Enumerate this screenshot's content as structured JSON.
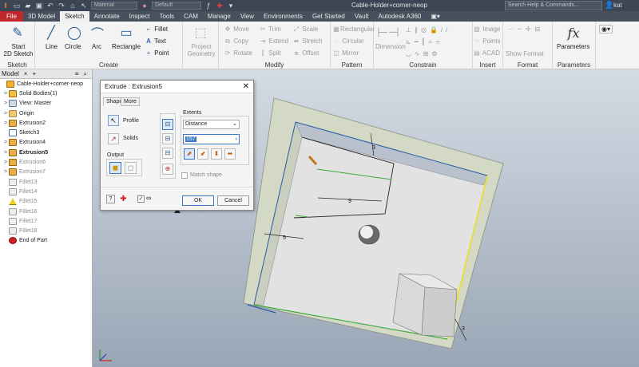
{
  "titlebar": {
    "title": "Cable-Holder+corner-neop",
    "material": "Material",
    "appearance": "Default",
    "search_placeholder": "Search Help & Commands...",
    "user": "kat"
  },
  "tabs": [
    "File",
    "3D Model",
    "Sketch",
    "Annotate",
    "Inspect",
    "Tools",
    "CAM",
    "Manage",
    "View",
    "Environments",
    "Get Started",
    "Vault",
    "Autodesk A360"
  ],
  "ribbon": {
    "sketch_panel": {
      "label": "Sketch",
      "start_line1": "Start",
      "start_line2": "2D Sketch"
    },
    "create_panel": {
      "label": "Create",
      "line": "Line",
      "circle": "Circle",
      "arc": "Arc",
      "rectangle": "Rectangle",
      "fillet": "Fillet",
      "text": "Text",
      "point": "Point"
    },
    "project_panel": {
      "line1": "Project",
      "line2": "Geometry"
    },
    "modify_panel": {
      "label": "Modify",
      "move": "Move",
      "copy": "Copy",
      "rotate": "Rotate",
      "trim": "Trim",
      "extend": "Extend",
      "split": "Split",
      "scale": "Scale",
      "stretch": "Stretch",
      "offset": "Offset"
    },
    "pattern_panel": {
      "label": "Pattern",
      "rectangular": "Rectangular",
      "circular": "Circular",
      "mirror": "Mirror"
    },
    "constrain_panel": {
      "label": "Constrain",
      "dimension": "Dimension"
    },
    "insert_panel": {
      "label": "Insert",
      "image": "Image",
      "points": "Points",
      "acad": "ACAD"
    },
    "format_panel": {
      "label": "Format",
      "show_format": "Show Format"
    },
    "parameters_panel": {
      "label": "Parameters",
      "parameters": "Parameters"
    }
  },
  "browser": {
    "tab": "Model",
    "items": [
      {
        "label": "Cable-Holder+corner-neop",
        "indent": 0,
        "arrow": "",
        "icon": "part-icon",
        "bold": false,
        "dim": false
      },
      {
        "label": "Solid Bodies(1)",
        "indent": 1,
        "arrow": ">",
        "icon": "solid-bodies-icon",
        "bold": false,
        "dim": false
      },
      {
        "label": "View: Master",
        "indent": 1,
        "arrow": ">",
        "icon": "view-icon",
        "bold": false,
        "dim": false
      },
      {
        "label": "Origin",
        "indent": 1,
        "arrow": ">",
        "icon": "folder-icon",
        "bold": false,
        "dim": false
      },
      {
        "label": "Extrusion2",
        "indent": 1,
        "arrow": ">",
        "icon": "extrusion-icon",
        "bold": false,
        "dim": false
      },
      {
        "label": "Sketch3",
        "indent": 1,
        "arrow": "",
        "icon": "sketch-icon",
        "bold": false,
        "dim": false
      },
      {
        "label": "Extrusion4",
        "indent": 1,
        "arrow": ">",
        "icon": "extrusion-icon",
        "bold": false,
        "dim": false
      },
      {
        "label": "Extrusion5",
        "indent": 1,
        "arrow": ">",
        "icon": "extrusion-icon",
        "bold": true,
        "dim": false
      },
      {
        "label": "Extrusion6",
        "indent": 1,
        "arrow": ">",
        "icon": "extrusion-icon",
        "bold": false,
        "dim": true
      },
      {
        "label": "Extrusion7",
        "indent": 1,
        "arrow": ">",
        "icon": "extrusion-icon",
        "bold": false,
        "dim": true
      },
      {
        "label": "Fillet13",
        "indent": 1,
        "arrow": "",
        "icon": "fillet-icon",
        "bold": false,
        "dim": true
      },
      {
        "label": "Fillet14",
        "indent": 1,
        "arrow": "",
        "icon": "fillet-icon",
        "bold": false,
        "dim": true
      },
      {
        "label": "Fillet15",
        "indent": 1,
        "arrow": "",
        "icon": "warning-icon",
        "bold": false,
        "dim": true
      },
      {
        "label": "Fillet16",
        "indent": 1,
        "arrow": "",
        "icon": "fillet-icon",
        "bold": false,
        "dim": true
      },
      {
        "label": "Fillet17",
        "indent": 1,
        "arrow": "",
        "icon": "fillet-icon",
        "bold": false,
        "dim": true
      },
      {
        "label": "Fillet18",
        "indent": 1,
        "arrow": "",
        "icon": "fillet-icon",
        "bold": false,
        "dim": true
      },
      {
        "label": "End of Part",
        "indent": 1,
        "arrow": "",
        "icon": "end-of-part-icon",
        "bold": false,
        "dim": false
      }
    ]
  },
  "dialog": {
    "title": "Extrude : Extrusion5",
    "tab_shape": "Shape",
    "tab_more": "More",
    "profile": "Profile",
    "solids": "Solids",
    "output": "Output",
    "extents_label": "Extents",
    "extents_value": "Distance",
    "distance_value": "157",
    "match_shape": "Match shape",
    "ok": "OK",
    "cancel": "Cancel"
  },
  "viewport": {
    "dim_9": "9",
    "dim_5": "5",
    "dim_3a": "3",
    "dim_3b": "3"
  },
  "colors": {
    "file_tab": "#c0272d",
    "titlebar": "#3b4553",
    "accent": "#3b78c4",
    "edge_yellow": "#e8e020",
    "edge_green": "#3caa3c"
  }
}
